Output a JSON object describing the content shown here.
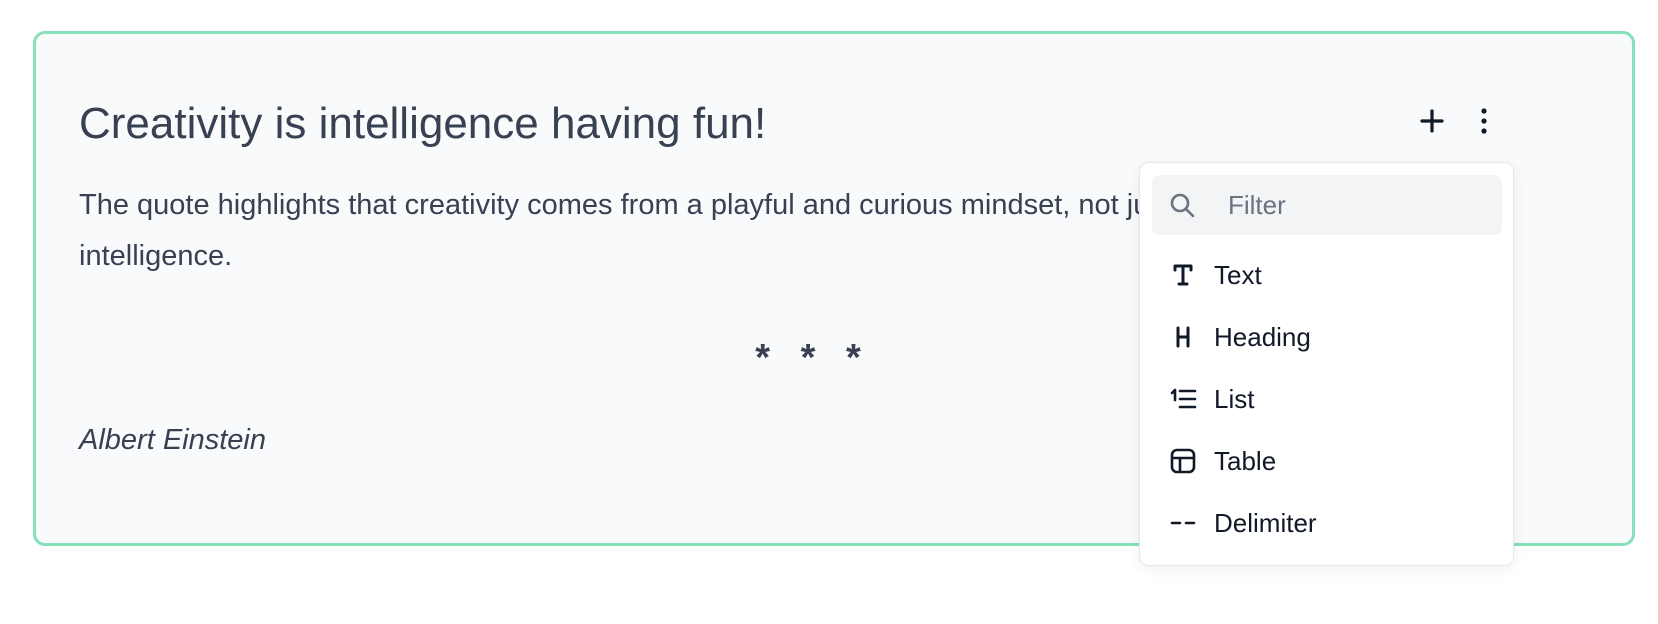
{
  "content": {
    "heading": "Creativity is intelligence having fun!",
    "paragraph": "The quote highlights that creativity comes from a playful and curious mindset, not just intelligence.",
    "delimiter": "* * *",
    "author": "Albert Einstein"
  },
  "toolbar": {
    "add_icon": "plus-icon",
    "more_icon": "more-vertical-icon"
  },
  "block_menu": {
    "filter_placeholder": "Filter",
    "filter_value": "",
    "items": [
      {
        "icon": "text-icon",
        "label": "Text"
      },
      {
        "icon": "heading-icon",
        "label": "Heading"
      },
      {
        "icon": "list-icon",
        "label": "List"
      },
      {
        "icon": "table-icon",
        "label": "Table"
      },
      {
        "icon": "delimiter-icon",
        "label": "Delimiter"
      }
    ]
  },
  "colors": {
    "card_border": "#86e0b8",
    "card_background": "#f9fafb",
    "text": "#374151",
    "menu_text": "#111827",
    "filter_background": "#f3f4f6"
  }
}
